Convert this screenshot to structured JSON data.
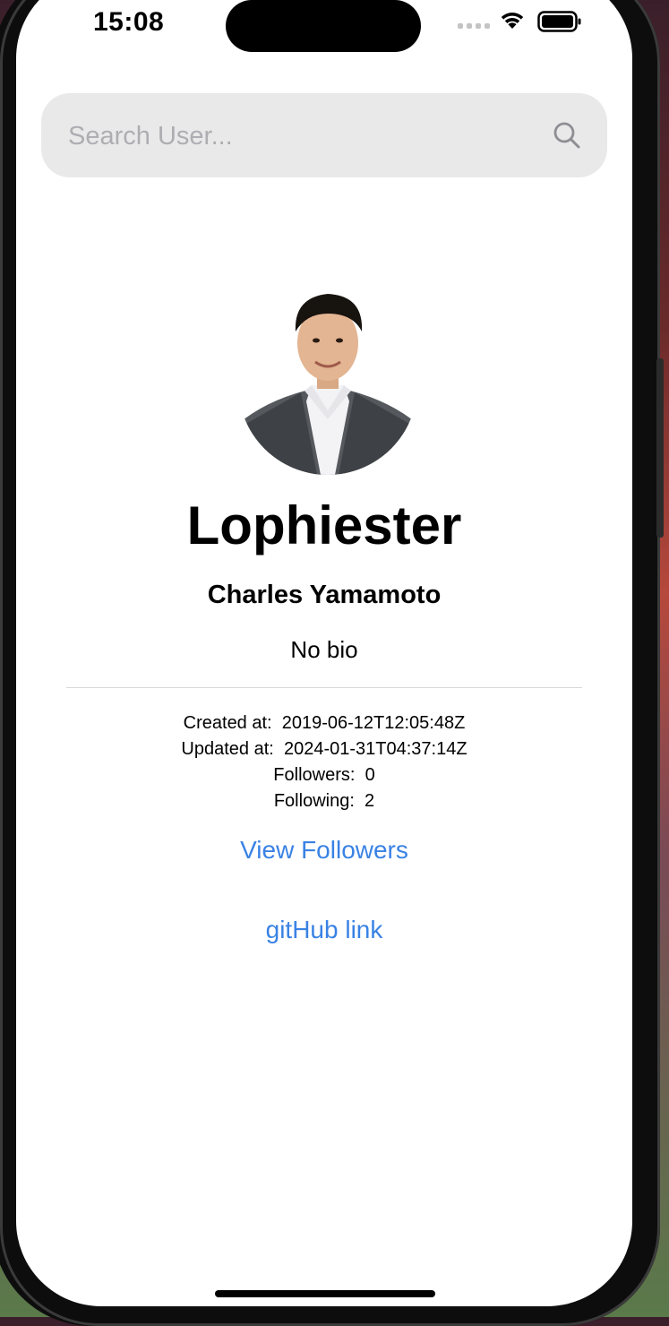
{
  "status_bar": {
    "time": "15:08"
  },
  "search": {
    "placeholder": "Search User...",
    "value": ""
  },
  "profile": {
    "username": "Lophiester",
    "full_name": "Charles Yamamoto",
    "bio": "No bio",
    "stats": {
      "created": {
        "label": "Created at:",
        "value": "2019-06-12T12:05:48Z"
      },
      "updated": {
        "label": "Updated at:",
        "value": "2024-01-31T04:37:14Z"
      },
      "followers": {
        "label": "Followers:",
        "value": "0"
      },
      "following": {
        "label": "Following:",
        "value": "2"
      }
    }
  },
  "links": {
    "view_followers": "View Followers",
    "github": "gitHub link"
  },
  "colors": {
    "link": "#3a82e4",
    "search_bg": "#e9e9ea",
    "placeholder": "#aeaeb2"
  }
}
